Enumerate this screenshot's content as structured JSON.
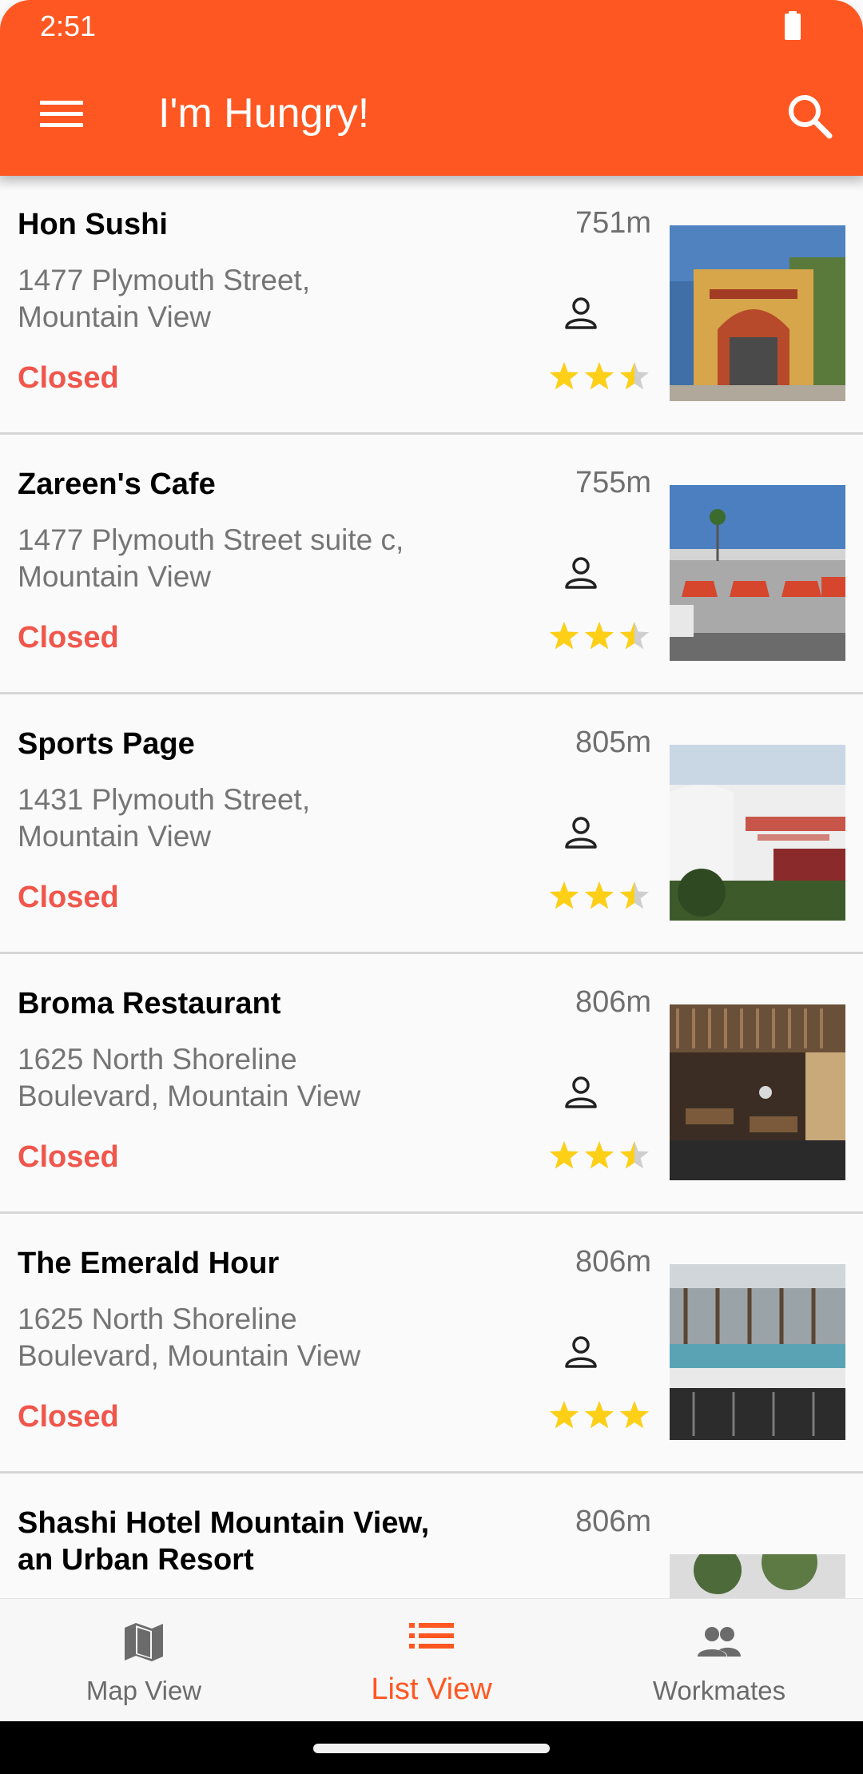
{
  "status_bar": {
    "time": "2:51",
    "battery_icon": "battery-full-icon"
  },
  "app_bar": {
    "title": "I'm Hungry!",
    "menu_icon": "menu-icon",
    "search_icon": "search-icon",
    "color": "#FF5722"
  },
  "restaurants": [
    {
      "name": "Hon Sushi",
      "address": "1477 Plymouth Street,\nMountain View",
      "status": "Closed",
      "distance": "751m",
      "rating": 2.5,
      "photo": "storefront-arch"
    },
    {
      "name": "Zareen's Cafe",
      "address": "1477 Plymouth Street suite c,\nMountain View",
      "status": "Closed",
      "distance": "755m",
      "rating": 2.5,
      "photo": "storefront-awnings"
    },
    {
      "name": "Sports Page",
      "address": "1431 Plymouth Street,\nMountain View",
      "status": "Closed",
      "distance": "805m",
      "rating": 2.5,
      "photo": "sports-page-sign"
    },
    {
      "name": "Broma Restaurant",
      "address": "1625 North Shoreline\nBoulevard, Mountain View",
      "status": "Closed",
      "distance": "806m",
      "rating": 2.5,
      "photo": "dining-room"
    },
    {
      "name": "The Emerald Hour",
      "address": "1625 North Shoreline\nBoulevard, Mountain View",
      "status": "Closed",
      "distance": "806m",
      "rating": 3,
      "photo": "bar-counter"
    },
    {
      "name": "Shashi Hotel Mountain View,\nan Urban Resort",
      "address": "",
      "status": "",
      "distance": "806m",
      "rating": 0,
      "photo": "hotel-trees"
    }
  ],
  "bottom_nav": {
    "items": [
      {
        "label": "Map View",
        "icon": "map-icon",
        "active": false
      },
      {
        "label": "List View",
        "icon": "list-icon",
        "active": true
      },
      {
        "label": "Workmates",
        "icon": "people-icon",
        "active": false
      }
    ]
  },
  "colors": {
    "closed": "#F0564C",
    "star": "#FDD017",
    "star_empty": "#CFCFCF",
    "accent": "#FF5722"
  }
}
